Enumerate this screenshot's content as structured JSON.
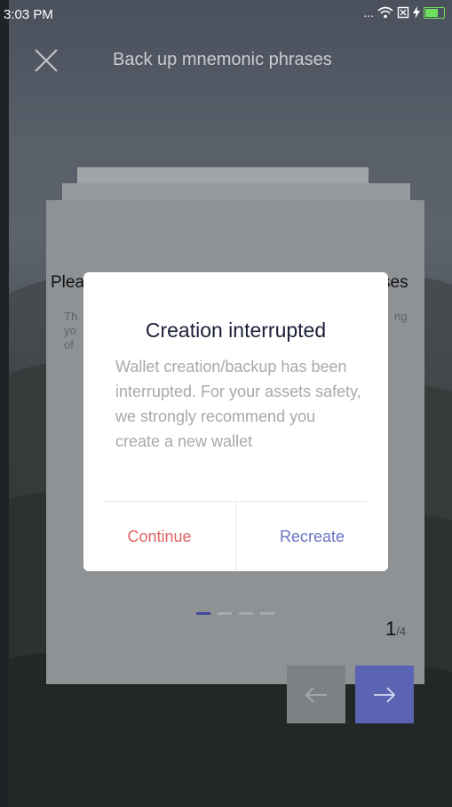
{
  "status_bar": {
    "time": "3:03 PM",
    "more_indicator": "...",
    "icons": [
      "wifi-icon",
      "sim-x-icon",
      "charging-icon",
      "battery-icon"
    ],
    "battery_color": "#6ee05e"
  },
  "header": {
    "title": "Back up mnemonic phrases",
    "close_icon": "close-icon"
  },
  "card": {
    "title_left_partial": "Plea",
    "title_right_partial": "ses",
    "subtext_left_partial": "Th\nyo\nof",
    "subtext_right_partial": "ng",
    "page_current": "1",
    "page_total": "/4",
    "dots_total": 4,
    "dots_active_index": 0
  },
  "navigation": {
    "prev_icon": "arrow-left-icon",
    "next_icon": "arrow-right-icon",
    "next_color": "#5b64b2"
  },
  "modal": {
    "title": "Creation interrupted",
    "body": "Wallet creation/backup has been interrupted. For your assets safety, we strongly recommend you create a new wallet",
    "continue_label": "Continue",
    "recreate_label": "Recreate",
    "continue_color": "#e26565",
    "recreate_color": "#6a72c4"
  }
}
